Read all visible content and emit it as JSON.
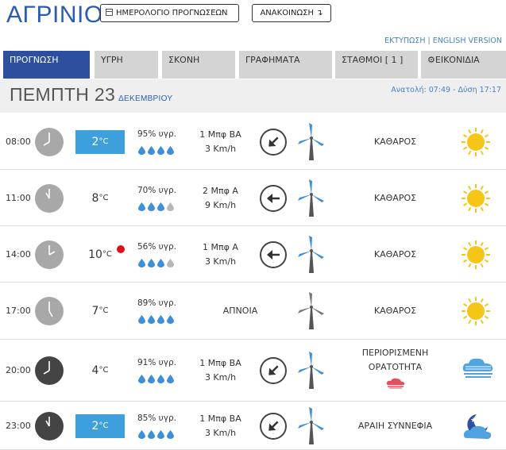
{
  "header": {
    "city": "ΑΓΡΙΝΙΟ",
    "calendar_button": "ΗΜΕΡΟΛΟΓΙΟ ΠΡΟΓΝΩΣΕΩΝ",
    "announcement_button": "ΑΝΑΚΟΙΝΩΣΗ ↴",
    "print_link": "ΕΚΤΥΠΩΣΗ",
    "separator": " | ",
    "english_link": "ENGLISH VERSION"
  },
  "tabs": [
    "ΠΡΟΓΝΩΣΗ",
    "ΥΓΡΗ",
    "ΣΚΟΝΗ",
    "ΓΡΑΦΗΜΑΤΑ",
    "ΣΤΑΘΜΟΙ  [ 1 ]",
    "ΕΙΚΟΝΙΔΙΑ"
  ],
  "day": {
    "name": "ΠΕΜΠΤΗ 23",
    "month": "ΔΕΚΕΜΒΡΙΟΥ",
    "sun": "Ανατολή: 07:49  - Δύση 17:17"
  },
  "units": {
    "temp": "°C"
  },
  "rows": [
    {
      "time": "08:00",
      "temp": "2",
      "humidity": "95% υγρ.",
      "drops": 4,
      "wind1": "1 Μπφ ΒΑ",
      "wind2": "3 Km/h",
      "wind_dir": "NE",
      "condition": "ΚΑΘΑΡΟΣ",
      "condition2": "",
      "icon": "sun-icon"
    },
    {
      "time": "11:00",
      "temp": "8",
      "humidity": "70% υγρ.",
      "drops": 3,
      "wind1": "2 Μπφ Α",
      "wind2": "9 Km/h",
      "wind_dir": "E",
      "condition": "ΚΑΘΑΡΟΣ",
      "condition2": "",
      "icon": "sun-icon"
    },
    {
      "time": "14:00",
      "temp": "10",
      "humidity": "56% υγρ.",
      "drops": 3,
      "wind1": "1 Μπφ Α",
      "wind2": "3 Km/h",
      "wind_dir": "E",
      "condition": "ΚΑΘΑΡΟΣ",
      "condition2": "",
      "icon": "sun-icon"
    },
    {
      "time": "17:00",
      "temp": "7",
      "humidity": "89% υγρ.",
      "drops": 4,
      "wind1": "ΑΠΝΟΙΑ",
      "wind2": "",
      "wind_dir": "",
      "condition": "ΚΑΘΑΡΟΣ",
      "condition2": "",
      "icon": "sun-icon"
    },
    {
      "time": "20:00",
      "temp": "4",
      "humidity": "91% υγρ.",
      "drops": 4,
      "wind1": "1 Μπφ ΒΑ",
      "wind2": "3 Km/h",
      "wind_dir": "NE",
      "condition": "ΠΕΡΙΟΡΙΣΜΕΝΗ",
      "condition2": "ΟΡΑΤΟΤΗΤΑ",
      "icon": "fog-icon"
    },
    {
      "time": "23:00",
      "temp": "2",
      "humidity": "85% υγρ.",
      "drops": 4,
      "wind1": "1 Μπφ ΒΑ",
      "wind2": "3 Km/h",
      "wind_dir": "NE",
      "condition": "ΑΡΑΙΗ ΣΥΝΝΕΦΙΑ",
      "condition2": "",
      "icon": "moon-cloud-icon"
    }
  ],
  "colors": {
    "brand": "#2a5db0",
    "active_tab": "#2d4fa0",
    "cold_temp": "#3da0dd",
    "hot_dot": "#e0101a",
    "drop": "#3d8fd8"
  }
}
